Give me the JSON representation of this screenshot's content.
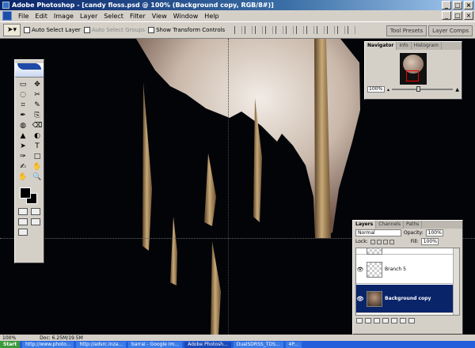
{
  "window": {
    "title": "Adobe Photoshop - [candy floss.psd @ 100% (Background copy, RGB/8#)]",
    "controls": [
      "_",
      "□",
      "×"
    ]
  },
  "menu": [
    "File",
    "Edit",
    "Image",
    "Layer",
    "Select",
    "Filter",
    "View",
    "Window",
    "Help"
  ],
  "options": {
    "auto_select_layer": "Auto Select Layer",
    "auto_select_groups": "Auto Select Groups",
    "show_transform_controls": "Show Transform Controls",
    "tool_presets_tab": "Tool Presets",
    "layer_comps_tab": "Layer Comps"
  },
  "toolbox": {
    "tools": [
      "▭",
      "✥",
      "◌",
      "✂",
      "⌗",
      "✎",
      "✒",
      "⎘",
      "◍",
      "⌫",
      "▲",
      "◐",
      "➤",
      "T",
      "✑",
      "□",
      "✍",
      "✋",
      "🔍"
    ]
  },
  "navigator": {
    "tabs": [
      "Navigator",
      "Info",
      "Histogram"
    ],
    "zoom": "100%"
  },
  "layers": {
    "tabs": [
      "Layers",
      "Channels",
      "Paths"
    ],
    "blend_mode": "Normal",
    "opacity_label": "Opacity:",
    "opacity": "100%",
    "lock_label": "Lock:",
    "fill_label": "Fill:",
    "fill": "100%",
    "items": [
      {
        "name": "",
        "visible": false
      },
      {
        "name": "Branch 5",
        "visible": true
      },
      {
        "name": "Background copy",
        "visible": true
      }
    ]
  },
  "status": {
    "zoom": "100%",
    "doc": "Doc: 6.25M/19.5M"
  },
  "taskbar": {
    "start": "Start",
    "tasks": [
      "http://www.photo...",
      "http://adsrc.inza...",
      "barrai - Google Im...",
      "Adobe Photosh...",
      "DualSDRSS_TDS...",
      "4P..."
    ]
  },
  "colors": {
    "title_active": "#0a246a",
    "chrome": "#d4d0c8",
    "canvas": "#020408",
    "selection": "#0a246a"
  }
}
